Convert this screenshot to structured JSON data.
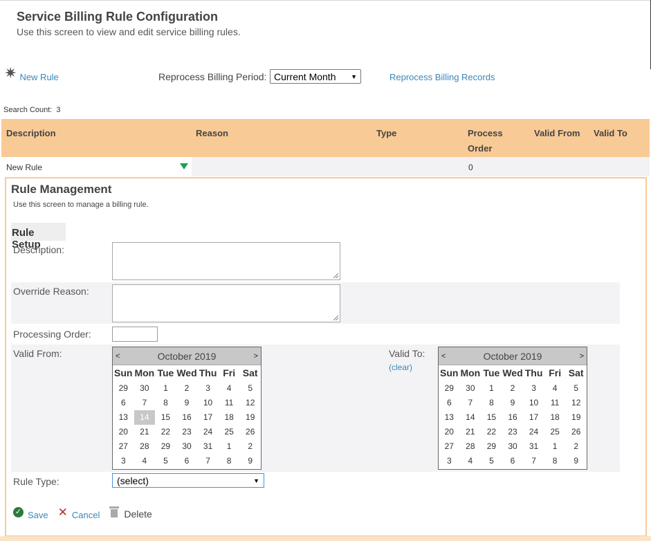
{
  "page": {
    "title": "Service Billing Rule Configuration",
    "subtitle": "Use this screen to view and edit service billing rules."
  },
  "toolbar": {
    "new_rule": "New Rule",
    "reprocess_label": "Reprocess Billing Period:",
    "period_value": "Current Month",
    "reprocess_records": "Reprocess Billing Records"
  },
  "search": {
    "label": "Search Count:",
    "count": "3"
  },
  "grid": {
    "columns": [
      "Description",
      "Reason",
      "Type",
      "Process Order",
      "Valid From",
      "Valid To"
    ],
    "rows": [
      {
        "description": "New Rule",
        "reason": "",
        "type": "",
        "process_order": "0",
        "valid_from": "",
        "valid_to": ""
      }
    ]
  },
  "rule_management": {
    "title": "Rule Management",
    "subtitle": "Use this screen to manage a billing rule.",
    "setup_title": "Rule Setup",
    "description_label": "Description:",
    "override_reason_label": "Override Reason:",
    "processing_order_label": "Processing Order:",
    "valid_from_label": "Valid From:",
    "valid_to_label": "Valid To:",
    "clear_label": "(clear)",
    "rule_type_label": "Rule Type:",
    "rule_type_value": "(select)"
  },
  "calendar_from": {
    "prev": "<",
    "next": ">",
    "title": "October 2019",
    "days_of_week": [
      "Sun",
      "Mon",
      "Tue",
      "Wed",
      "Thu",
      "Fri",
      "Sat"
    ],
    "weeks": [
      [
        "29",
        "30",
        "1",
        "2",
        "3",
        "4",
        "5"
      ],
      [
        "6",
        "7",
        "8",
        "9",
        "10",
        "11",
        "12"
      ],
      [
        "13",
        "14",
        "15",
        "16",
        "17",
        "18",
        "19"
      ],
      [
        "20",
        "21",
        "22",
        "23",
        "24",
        "25",
        "26"
      ],
      [
        "27",
        "28",
        "29",
        "30",
        "31",
        "1",
        "2"
      ],
      [
        "3",
        "4",
        "5",
        "6",
        "7",
        "8",
        "9"
      ]
    ],
    "selected": "14"
  },
  "calendar_to": {
    "prev": "<",
    "next": ">",
    "title": "October 2019",
    "days_of_week": [
      "Sun",
      "Mon",
      "Tue",
      "Wed",
      "Thu",
      "Fri",
      "Sat"
    ],
    "weeks": [
      [
        "29",
        "30",
        "1",
        "2",
        "3",
        "4",
        "5"
      ],
      [
        "6",
        "7",
        "8",
        "9",
        "10",
        "11",
        "12"
      ],
      [
        "13",
        "14",
        "15",
        "16",
        "17",
        "18",
        "19"
      ],
      [
        "20",
        "21",
        "22",
        "23",
        "24",
        "25",
        "26"
      ],
      [
        "27",
        "28",
        "29",
        "30",
        "31",
        "1",
        "2"
      ],
      [
        "3",
        "4",
        "5",
        "6",
        "7",
        "8",
        "9"
      ]
    ],
    "selected": ""
  },
  "actions": {
    "save": "Save",
    "cancel": "Cancel",
    "delete": "Delete"
  },
  "icons": {
    "new_rule": "burst-star-icon",
    "save": "check-circle-icon",
    "cancel": "x-icon",
    "delete": "trash-icon"
  },
  "colors": {
    "header_bg": "#f8ca95",
    "link": "#3a87b8",
    "save_green": "#2a7a3b",
    "cancel_red": "#c0272d"
  }
}
